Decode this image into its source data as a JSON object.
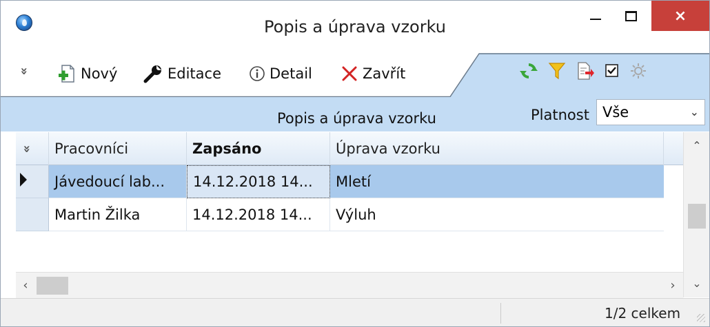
{
  "window": {
    "title": "Popis a úprava vzorku",
    "close_label": "×"
  },
  "toolbar": {
    "overflow_label": "»",
    "new_label": "Nový",
    "edit_label": "Editace",
    "detail_label": "Detail",
    "close_label": "Zavřít",
    "right_icons": [
      "refresh-icon",
      "filter-icon",
      "export-icon",
      "checkbox-icon",
      "settings-icon"
    ]
  },
  "filter": {
    "title": "Popis a úprava vzorku",
    "platnost_label": "Platnost",
    "platnost_value": "Vše"
  },
  "grid": {
    "columns": [
      "Pracovníci",
      "Zapsáno",
      "Úprava vzorku"
    ],
    "rows": [
      {
        "pracovnici": "Jávedoucí lab...",
        "zapsano": "14.12.2018 14...",
        "uprava": "Mletí"
      },
      {
        "pracovnici": "Martin Žilka",
        "zapsano": "14.12.2018 14...",
        "uprava": "Výluh"
      }
    ]
  },
  "status": {
    "count_text": "1/2 celkem"
  },
  "colors": {
    "accent_band": "#c3dcf4",
    "selected_row": "#a8c9ec",
    "close_button": "#c7403a"
  }
}
